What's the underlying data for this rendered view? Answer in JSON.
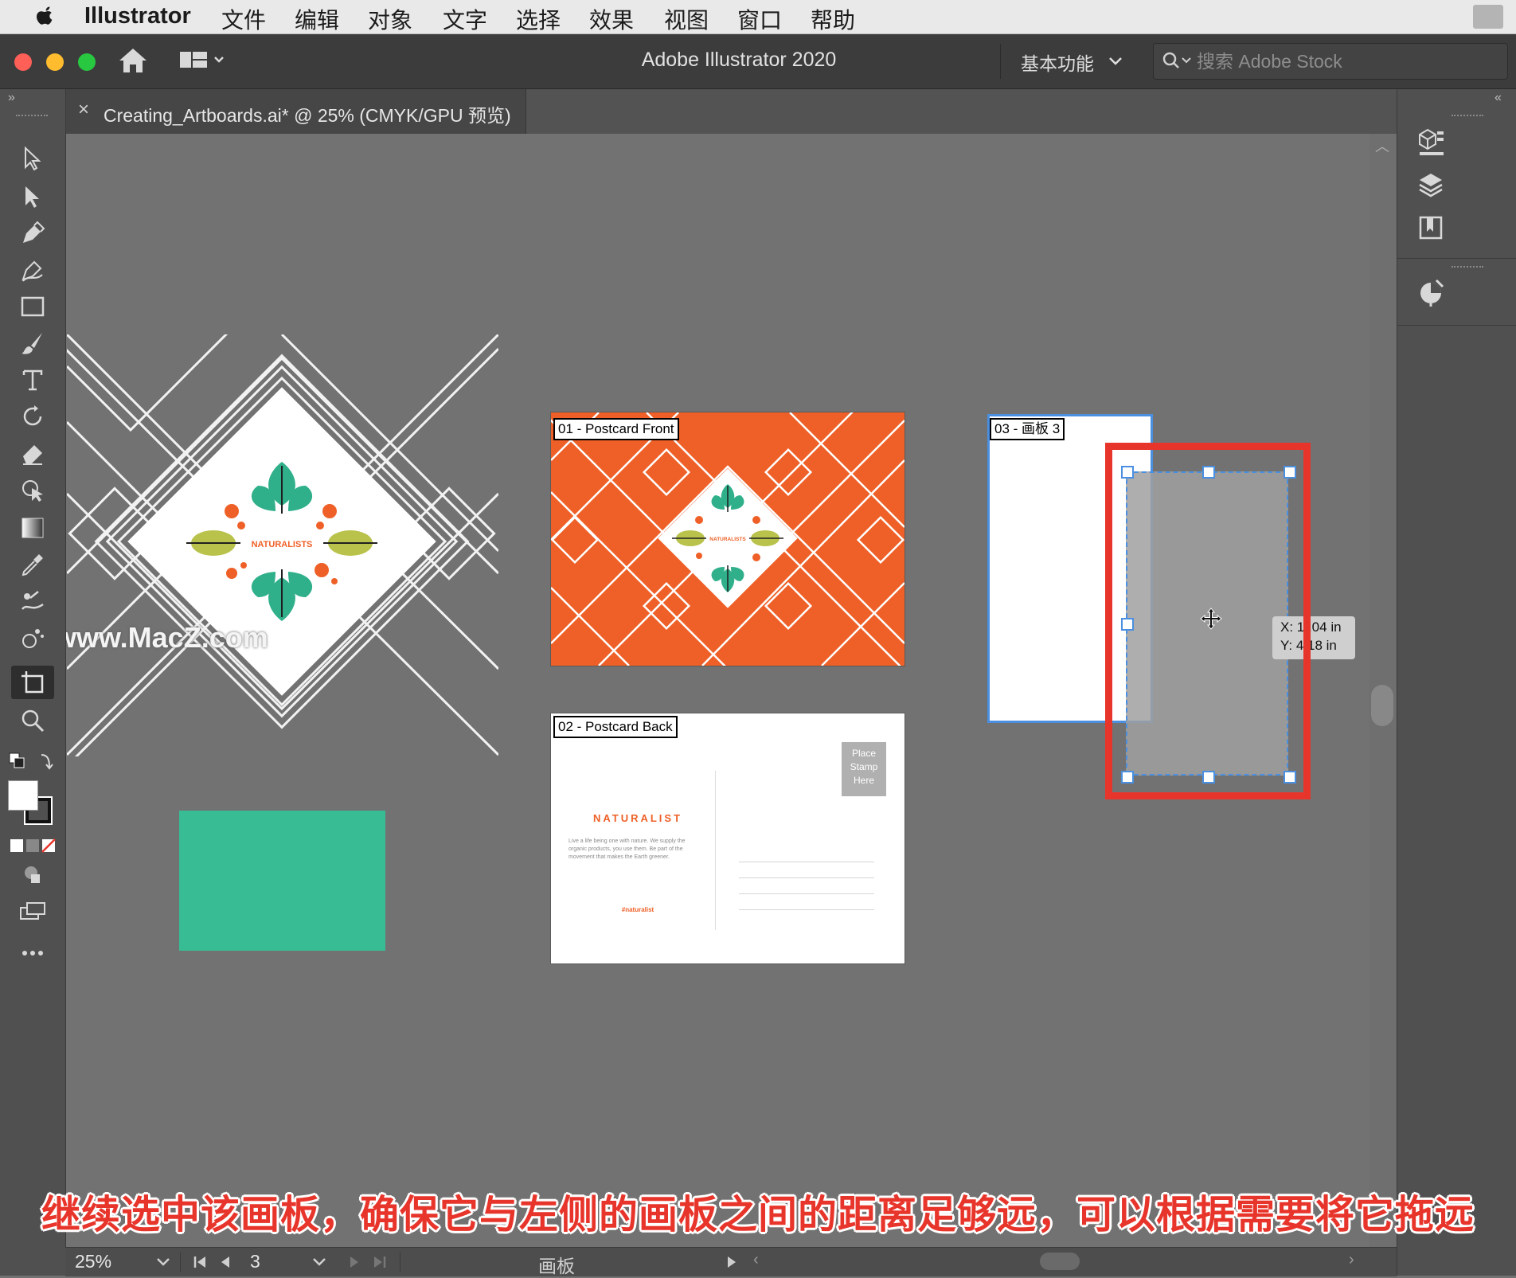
{
  "menubar": {
    "app_name": "Illustrator",
    "items": [
      "文件",
      "编辑",
      "对象",
      "文字",
      "选择",
      "效果",
      "视图",
      "窗口",
      "帮助"
    ]
  },
  "titlebar": {
    "window_title": "Adobe Illustrator 2020",
    "workspace": "基本功能",
    "search_placeholder": "搜索 Adobe Stock"
  },
  "document_tab": {
    "close": "×",
    "title": "Creating_Artboards.ai* @ 25% (CMYK/GPU 预览)"
  },
  "artboards": {
    "ab1_label": "01 - Postcard Front",
    "ab2_label": "02 - Postcard Back",
    "ab3_label": "03 - 画板 3"
  },
  "postcard_front": {
    "brand": "NATURALISTS"
  },
  "postcard_back": {
    "stamp_text": "Place Stamp Here",
    "heading": "NATURALIST",
    "body": "Live a life being one with nature. We supply the organic products, you use them. Be part of the movement that makes the Earth greener.",
    "hashtag": "#naturalist"
  },
  "pasteboard_art": {
    "brand": "NATURALISTS"
  },
  "move_tooltip": {
    "x": "X: 1  .04 in",
    "y": "Y: 4  18 in"
  },
  "statusbar": {
    "zoom": "25%",
    "artboard_number": "3",
    "tool_label": "画板"
  },
  "watermark": "www.MacZ.com",
  "caption": "继续选中该画板，确保它与左侧的画板之间的距离足够远，可以根据需要将它拖远",
  "colors": {
    "canvas": "#727272",
    "orange": "#ee6027",
    "teal": "#37bc93",
    "leaf": "#2fb08a",
    "olive": "#b9c24a",
    "highlight_red": "#e8352b",
    "selection_blue": "#4a8fe0"
  }
}
